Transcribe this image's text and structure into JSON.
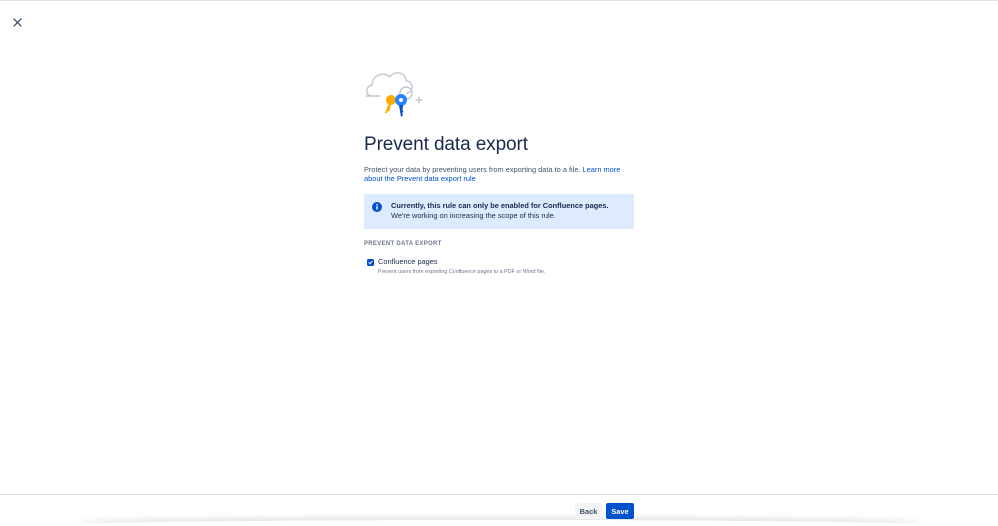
{
  "dialog": {
    "close_icon": "close-icon",
    "hero_icon": "cloud-keys-illustration",
    "title": "Prevent data export",
    "description_text": "Protect your data by preventing users from exporting data to a file. ",
    "learn_more_link": "Learn more about the Prevent data export rule",
    "info_banner": {
      "icon": "info-icon",
      "bold_text": "Currently, this rule can only be enabled for Confluence pages.",
      "text": " We're working on increasing the scope of this rule."
    },
    "section_label": "PREVENT DATA EXPORT",
    "options": [
      {
        "label": "Confluence pages",
        "help": "Prevent users from exporting Confluence pages to a PDF or Word file.",
        "checked": true
      }
    ]
  },
  "footer": {
    "back_label": "Back",
    "save_label": "Save"
  },
  "colors": {
    "primary": "#0052cc",
    "info_bg": "#deebff",
    "text": "#172b4d",
    "subtle_text": "#6b778c"
  }
}
